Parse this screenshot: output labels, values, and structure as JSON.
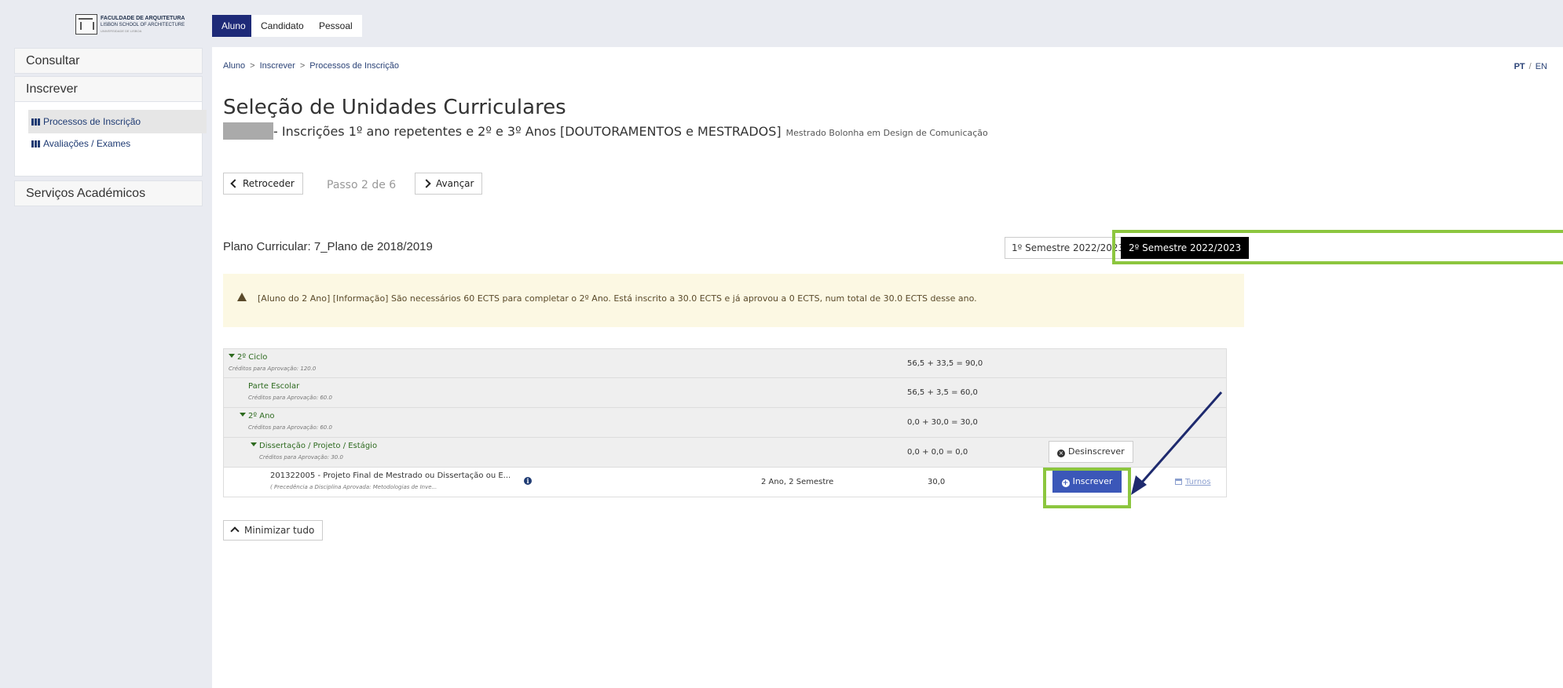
{
  "logo": {
    "line1": "FACULDADE DE ARQUITETURA",
    "line2": "LISBON SCHOOL OF ARCHITECTURE",
    "line3": "UNIVERSIDADE DE LISBOA"
  },
  "top_tabs": [
    {
      "label": "Aluno",
      "active": true
    },
    {
      "label": "Candidato",
      "active": false
    },
    {
      "label": "Pessoal",
      "active": false
    }
  ],
  "sidebar": {
    "consultar": "Consultar",
    "inscrever": "Inscrever",
    "items": [
      {
        "label": "Processos de Inscrição",
        "active": true
      },
      {
        "label": "Avaliações / Exames",
        "active": false
      }
    ],
    "servicos": "Serviços Académicos"
  },
  "breadcrumb": [
    "Aluno",
    "Inscrever",
    "Processos de Inscrição"
  ],
  "breadcrumb_sep": ">",
  "lang": {
    "pt": "PT",
    "sep": "/",
    "en": "EN"
  },
  "page": {
    "title": "Seleção de Unidades Curriculares",
    "subtitle": "- Inscrições 1º ano repetentes e 2º e 3º Anos [DOUTORAMENTOS e MESTRADOS]",
    "course": "Mestrado Bolonha em Design de Comunicação"
  },
  "nav": {
    "back": "Retroceder",
    "step": "Passo 2 de 6",
    "next": "Avançar"
  },
  "plan": {
    "label": "Plano Curricular: 7_Plano de 2018/2019",
    "sem1": "1º Semestre 2022/2023",
    "sem2": "2º Semestre 2022/2023"
  },
  "alert": {
    "text": "[Aluno do 2 Ano] [Informação] São necessários 60 ECTS para completar o 2º Ano. Está inscrito a 30.0 ECTS e já aprovou a 0 ECTS, num total de 30.0 ECTS desse ano."
  },
  "rows": [
    {
      "name": "2º Ciclo",
      "sub": "Créditos para Aprovação: 120.0",
      "credits": "56,5 + 33,5 = 90,0"
    },
    {
      "name": "Parte Escolar",
      "sub": "Créditos para Aprovação: 60.0",
      "credits": "56,5 + 3,5 = 60,0"
    },
    {
      "name": "2º Ano",
      "sub": "Créditos para Aprovação: 60.0",
      "credits": "0,0 + 30,0 = 30,0"
    },
    {
      "name": "Dissertação / Projeto / Estágio",
      "sub": "Créditos para Aprovação: 30.0",
      "credits": "0,0 + 0,0 = 0,0",
      "action": "Desinscrever"
    }
  ],
  "course_row": {
    "name": "201322005 - Projeto Final de Mestrado ou Dissertação ou E...",
    "sub": "( Precedência a Disciplina Aprovada: Metodologias de Inve...",
    "year_sem": "2 Ano, 2 Semestre",
    "ects": "30,0",
    "action": "Inscrever",
    "turnos": "Turnos"
  },
  "minimize": "Minimizar tudo",
  "colors": {
    "accent": "#1e2a78",
    "button_primary": "#3b57b8",
    "highlight": "#8cc63f",
    "annotation_arrow": "#1e2a6e",
    "alert_bg": "#fcf8e3"
  }
}
